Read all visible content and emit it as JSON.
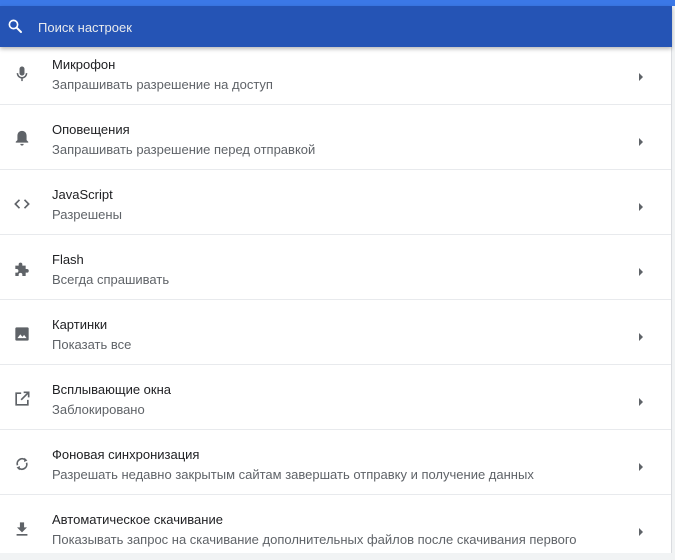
{
  "search": {
    "placeholder": "Поиск настроек",
    "icon": "search-icon"
  },
  "colors": {
    "header": "#2554b5",
    "accent": "#3b78e7",
    "icon": "#5f6368"
  },
  "rows": [
    {
      "icon": "microphone-icon",
      "title": "Микрофон",
      "subtitle": "Запрашивать разрешение на доступ"
    },
    {
      "icon": "bell-icon",
      "title": "Оповещения",
      "subtitle": "Запрашивать разрешение перед отправкой"
    },
    {
      "icon": "code-icon",
      "title": "JavaScript",
      "subtitle": "Разрешены"
    },
    {
      "icon": "puzzle-icon",
      "title": "Flash",
      "subtitle": "Всегда спрашивать"
    },
    {
      "icon": "image-icon",
      "title": "Картинки",
      "subtitle": "Показать все"
    },
    {
      "icon": "open-in-new-icon",
      "title": "Всплывающие окна",
      "subtitle": "Заблокировано"
    },
    {
      "icon": "sync-icon",
      "title": "Фоновая синхронизация",
      "subtitle": "Разрешать недавно закрытым сайтам завершать отправку и получение данных"
    },
    {
      "icon": "download-icon",
      "title": "Автоматическое скачивание",
      "subtitle": "Показывать запрос на скачивание дополнительных файлов после скачивания первого"
    }
  ]
}
